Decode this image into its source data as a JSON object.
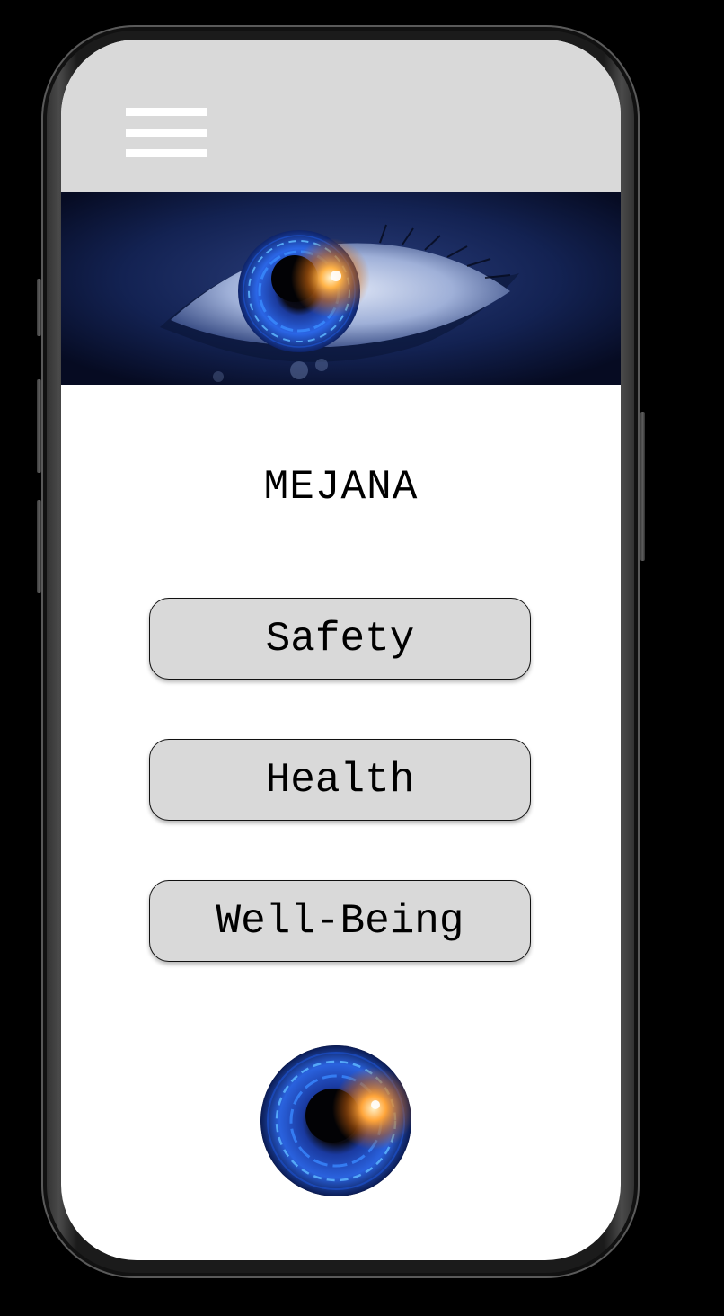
{
  "app": {
    "title": "MEJANA"
  },
  "header": {
    "menu_icon": "hamburger-menu-icon",
    "background_color": "#d9d9d9"
  },
  "hero": {
    "image": "cybernetic-eye-banner"
  },
  "nav": {
    "buttons": [
      {
        "label": "Safety"
      },
      {
        "label": "Health"
      },
      {
        "label": "Well-Being"
      }
    ]
  },
  "footer": {
    "logo_image": "cybernetic-eye-logo"
  },
  "colors": {
    "button_fill": "#d9d9d9",
    "page_background": "#ffffff",
    "device_background": "#000000"
  }
}
